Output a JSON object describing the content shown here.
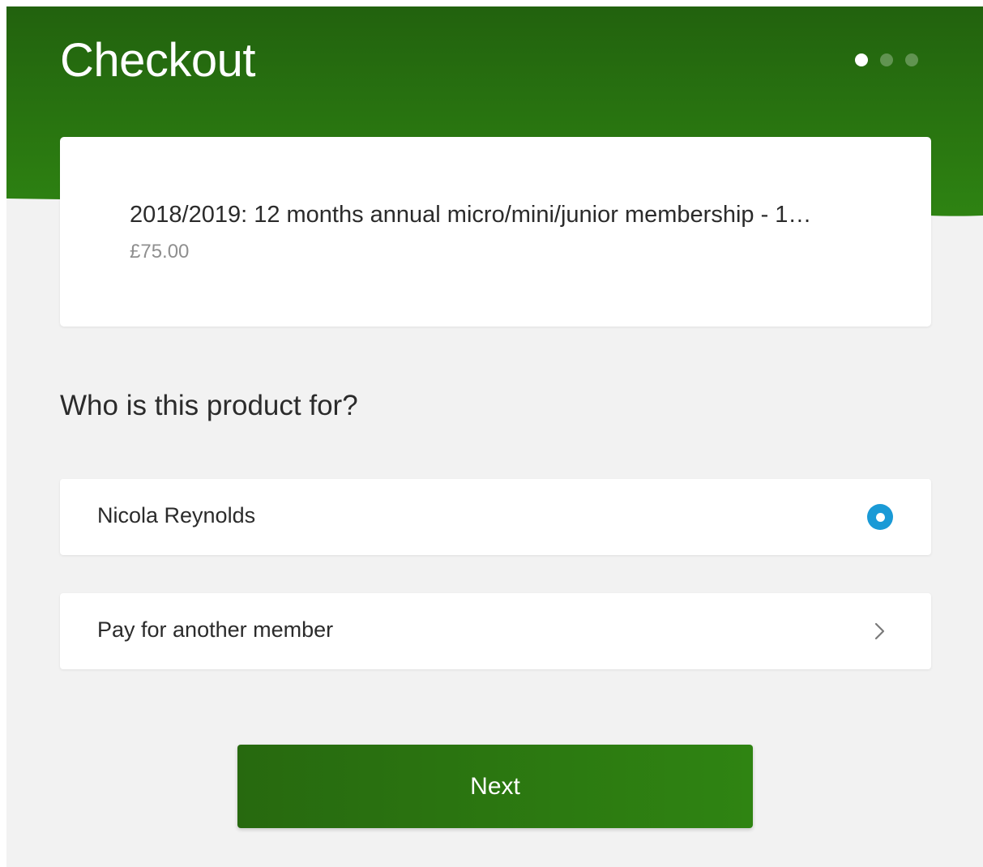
{
  "header": {
    "title": "Checkout",
    "steps": {
      "current": 1,
      "total": 3
    }
  },
  "product": {
    "name": "2018/2019: 12 months annual micro/mini/junior membership - 1…",
    "price": "£75.00"
  },
  "question": "Who is this product for?",
  "options": [
    {
      "label": "Nicola Reynolds",
      "selected": true,
      "icon": "radio-selected-icon"
    },
    {
      "label": "Pay for another member",
      "selected": false,
      "icon": "chevron-right-icon"
    }
  ],
  "next_label": "Next",
  "colors": {
    "brand_green_dark": "#22630e",
    "brand_green_light": "#2f8512",
    "radio_blue": "#1a9ad6",
    "background": "#f2f2f2"
  }
}
